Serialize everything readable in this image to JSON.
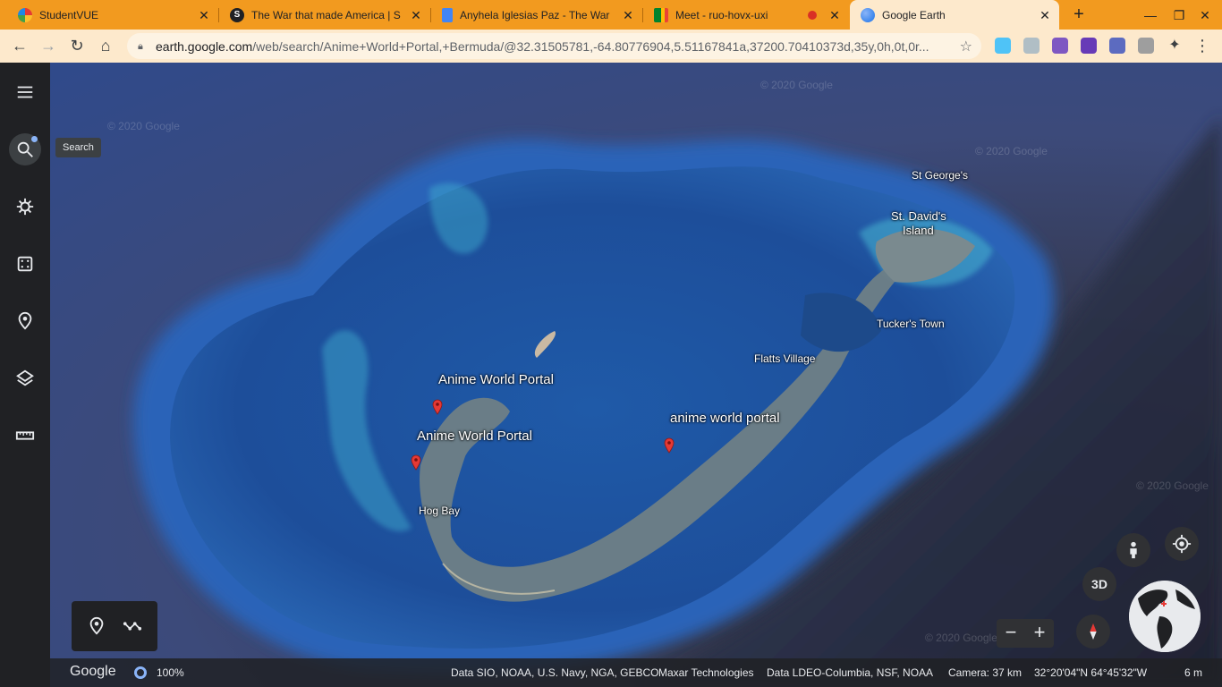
{
  "browser": {
    "tabs": [
      {
        "title": "StudentVUE",
        "icon": "studentvue-icon"
      },
      {
        "title": "The War that made America | S",
        "icon": "s-badge-icon"
      },
      {
        "title": "Anyhela Iglesias Paz - The War",
        "icon": "docs-icon"
      },
      {
        "title": "Meet - ruo-hovx-uxi",
        "icon": "meet-icon"
      },
      {
        "title": "Google Earth",
        "icon": "earth-icon"
      }
    ],
    "url_host": "earth.google.com",
    "url_path": "/web/search/Anime+World+Portal,+Bermuda/@32.31505781,-64.80776904,5.51167841a,37200.70410373d,35y,0h,0t,0r..."
  },
  "sidebar": {
    "tooltip": "Search",
    "items": [
      "menu-icon",
      "search-icon",
      "voyager-icon",
      "dice-icon",
      "projects-icon",
      "layers-icon",
      "ruler-icon"
    ]
  },
  "map": {
    "labels": {
      "st_georges": "St George's",
      "st_davids": "St. David's",
      "st_davids_2": "Island",
      "tuckers_town": "Tucker's Town",
      "flatts_village": "Flatts Village",
      "portal_1": "Anime World Portal",
      "portal_2": "Anime World Portal",
      "portal_3": "anime world portal",
      "hog_bay": "Hog Bay"
    },
    "watermark": "© 2020 Google"
  },
  "controls": {
    "three_d": "3D",
    "zoom_out": "−",
    "zoom_in": "+"
  },
  "status": {
    "logo": "Google",
    "zoom": "100%",
    "data_1": "Data SIO, NOAA, U.S. Navy, NGA, GEBCO",
    "data_2": "Maxar Technologies",
    "data_3": "Data LDEO-Columbia, NSF, NOAA",
    "camera": "Camera: 37 km",
    "coords": "32°20'04\"N 64°45'32\"W",
    "altitude": "6 m"
  },
  "colors": {
    "tab_bar": "#f29a1f",
    "active_tab": "#fde9cc",
    "pin": "#e53935",
    "sidebar": "#202124"
  }
}
